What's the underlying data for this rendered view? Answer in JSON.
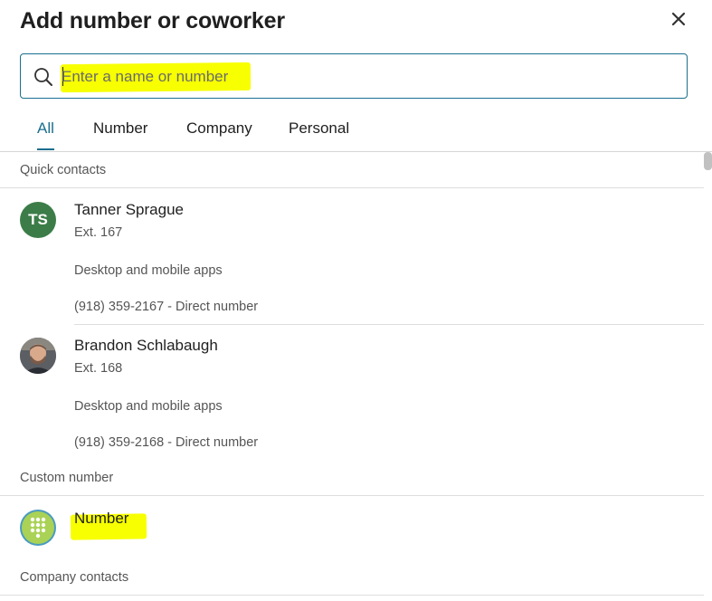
{
  "dialog": {
    "title": "Add number or coworker",
    "close_icon": "close-icon"
  },
  "search": {
    "placeholder": "Enter a name or number",
    "value": "",
    "icon": "search-icon"
  },
  "tabs": [
    {
      "label": "All",
      "active": true
    },
    {
      "label": "Number",
      "active": false
    },
    {
      "label": "Company",
      "active": false
    },
    {
      "label": "Personal",
      "active": false
    }
  ],
  "sections": {
    "quick_contacts": "Quick contacts",
    "custom_number": "Custom number",
    "company_contacts": "Company contacts"
  },
  "quick_contacts": [
    {
      "initials": "TS",
      "name": "Tanner Sprague",
      "ext": "Ext. 167",
      "apps": "Desktop and mobile apps",
      "phone": "(918) 359-2167 - Direct number",
      "avatar_color": "#3c7c48"
    },
    {
      "initials": "",
      "name": "Brandon Schlabaugh",
      "ext": "Ext. 168",
      "apps": "Desktop and mobile apps",
      "phone": "(918) 359-2168 - Direct number",
      "avatar": "photo"
    }
  ],
  "custom_number": {
    "label": "Number",
    "icon": "dialpad-icon"
  },
  "colors": {
    "accent": "#1b6e8f",
    "highlight": "#f7ff00",
    "avatar_green": "#3c7c48",
    "dialpad_bg": "#4a9bbf"
  }
}
